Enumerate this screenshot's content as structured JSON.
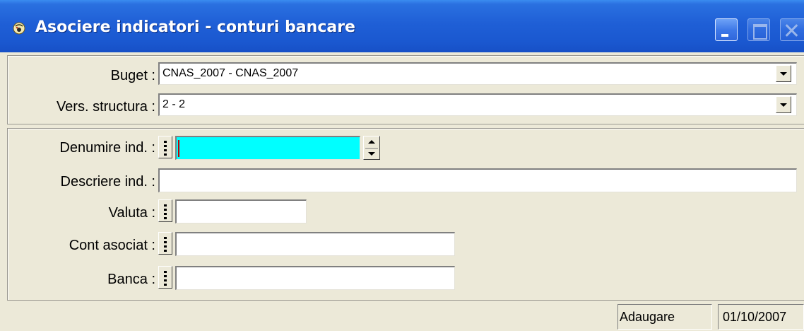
{
  "window": {
    "title": "Asociere indicatori - conturi bancare"
  },
  "header": {
    "buget_label": "Buget :",
    "buget_value": "CNAS_2007 - CNAS_2007",
    "vers_label": "Vers. structura :",
    "vers_value": "2 - 2"
  },
  "form": {
    "denumire_label": "Denumire ind. :",
    "denumire_value": "",
    "descriere_label": "Descriere ind. :",
    "descriere_value": "",
    "valuta_label": "Valuta :",
    "valuta_value": "",
    "cont_label": "Cont asociat :",
    "cont_value": "",
    "banca_label": "Banca :",
    "banca_value": ""
  },
  "status": {
    "mode": "Adaugare",
    "date": "01/10/2007"
  },
  "colors": {
    "active_field": "#00FFFF",
    "titlebar": "#1F5FD6",
    "window_bg": "#ECE9D8"
  },
  "icons": {
    "title": "oracle-forms-app-icon",
    "dropdown": "chevron-down-icon",
    "lov": "list-of-values-icon",
    "spinner": "spinner-arrows-icon"
  }
}
